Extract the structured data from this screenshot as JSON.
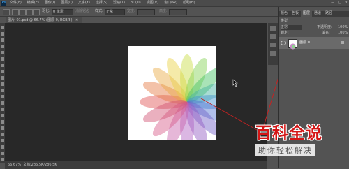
{
  "app": {
    "logo": "Ps"
  },
  "menu": [
    "文件(F)",
    "编辑(E)",
    "图像(I)",
    "图层(L)",
    "文字(Y)",
    "选择(S)",
    "滤镜(T)",
    "3D(D)",
    "视图(V)",
    "窗口(W)",
    "帮助(H)"
  ],
  "window_controls": [
    "—",
    "□",
    "✕"
  ],
  "options_bar": {
    "feather_label": "羽化:",
    "feather_value": "0 像素",
    "antialias_label": "消除锯齿",
    "style_label": "样式:",
    "style_value": "正常",
    "width_label": "宽度:",
    "height_label": "高度:"
  },
  "document_tab": {
    "title": "图片_01.psd @ 66.7% (图层 0, RGB/8)",
    "close": "✕"
  },
  "status_bar": {
    "zoom": "66.67%",
    "doc_info": "文档:286.5K/286.5K"
  },
  "panels": {
    "tabs": [
      "颜色",
      "色板",
      "图层",
      "通道",
      "路径"
    ],
    "active_tab": "图层",
    "kind_label": "类型",
    "blend_mode": "正常",
    "opacity_label": "不透明度:",
    "opacity_value": "100%",
    "lock_label": "锁定:",
    "fill_label": "填充:",
    "fill_value": "100%",
    "layer_name": "图层 0"
  },
  "watermark": {
    "title": "百科全说",
    "subtitle": "助你轻松解决"
  },
  "chart_data": null
}
